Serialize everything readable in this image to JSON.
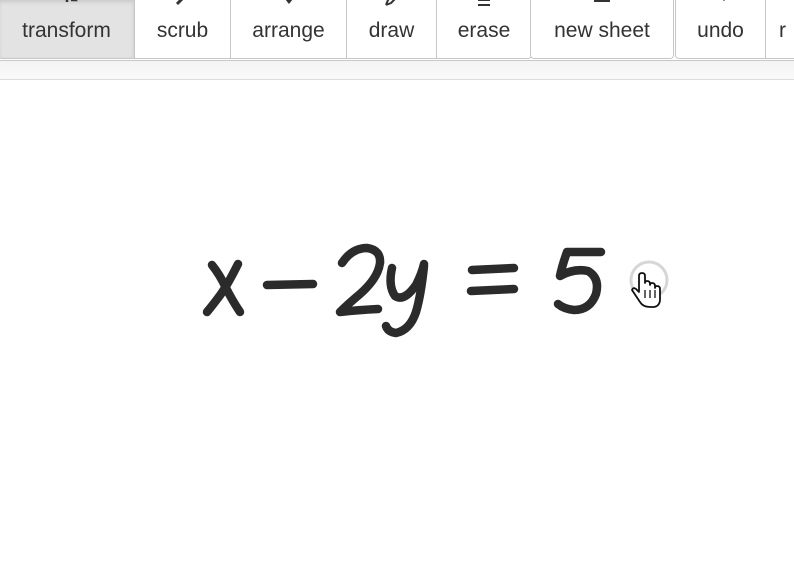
{
  "toolbar": {
    "tools": [
      {
        "label": "transform",
        "icon": "transform-icon",
        "active": true
      },
      {
        "label": "scrub",
        "icon": "scrub-icon",
        "active": false
      },
      {
        "label": "arrange",
        "icon": "arrange-icon",
        "active": false
      },
      {
        "label": "draw",
        "icon": "pencil-icon",
        "active": false
      },
      {
        "label": "erase",
        "icon": "eraser-icon",
        "active": false
      }
    ],
    "actions": [
      {
        "label": "new sheet",
        "icon": "new-sheet-icon"
      }
    ],
    "history": [
      {
        "label": "undo",
        "icon": "undo-icon"
      },
      {
        "label": "r",
        "icon": "redo-icon"
      }
    ]
  },
  "canvas": {
    "equation": {
      "lhs_var1": "x",
      "minus": "−",
      "coefficient": "2",
      "lhs_var2": "y",
      "equals": "=",
      "rhs": "5"
    },
    "ink_color": "#2b2b2b"
  },
  "cursor": {
    "icon": "hand-pointer-icon",
    "ring_icon": "cursor-ring-icon"
  }
}
